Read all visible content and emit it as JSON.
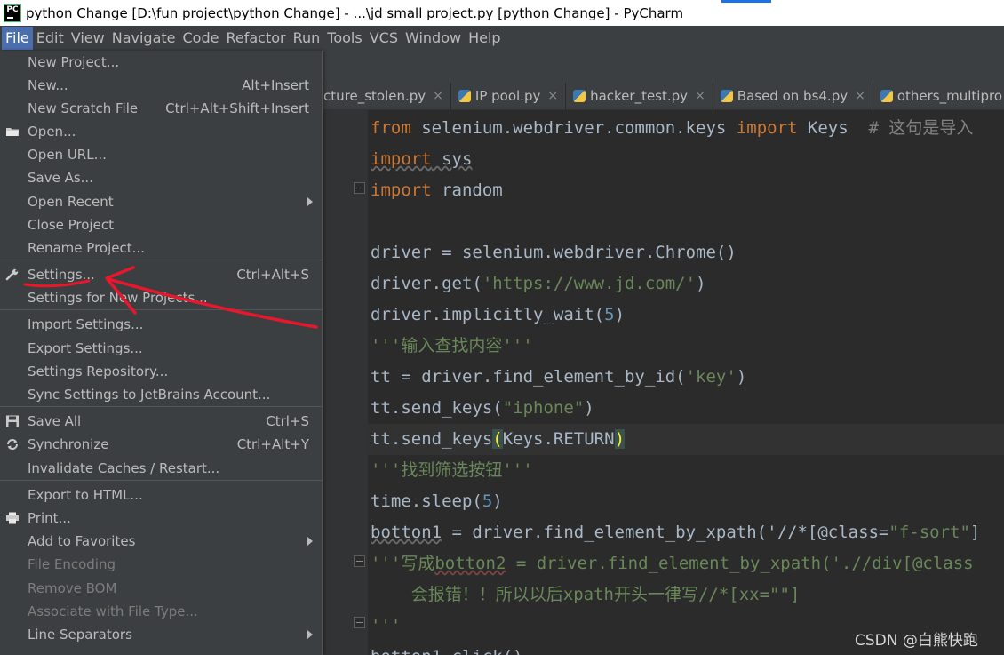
{
  "window": {
    "title": "python Change [D:\\fun project\\python Change] - ...\\jd small project.py [python Change] - PyCharm",
    "logo": "PC"
  },
  "menubar": [
    "File",
    "Edit",
    "View",
    "Navigate",
    "Code",
    "Refactor",
    "Run",
    "Tools",
    "VCS",
    "Window",
    "Help"
  ],
  "tabs": [
    "cture_stolen.py",
    "IP pool.py",
    "hacker_test.py",
    "Based on bs4.py",
    "others_multipro"
  ],
  "tab_close_glyph": "×",
  "file_menu": [
    {
      "label": "New Project...",
      "shortcut": ""
    },
    {
      "label": "New...",
      "shortcut": "Alt+Insert"
    },
    {
      "label": "New Scratch File",
      "shortcut": "Ctrl+Alt+Shift+Insert"
    },
    {
      "label": "Open...",
      "shortcut": "",
      "icon": "folder-icon"
    },
    {
      "label": "Open URL...",
      "shortcut": ""
    },
    {
      "label": "Save As...",
      "shortcut": ""
    },
    {
      "label": "Open Recent",
      "shortcut": "",
      "submenu": true
    },
    {
      "label": "Close Project",
      "shortcut": ""
    },
    {
      "label": "Rename Project...",
      "shortcut": ""
    },
    {
      "label": "Settings...",
      "shortcut": "Ctrl+Alt+S",
      "icon": "wrench-icon"
    },
    {
      "label": "Settings for New Projects...",
      "shortcut": ""
    },
    {
      "label": "Import Settings...",
      "shortcut": ""
    },
    {
      "label": "Export Settings...",
      "shortcut": ""
    },
    {
      "label": "Settings Repository...",
      "shortcut": ""
    },
    {
      "label": "Sync Settings to JetBrains Account...",
      "shortcut": ""
    },
    {
      "label": "Save All",
      "shortcut": "Ctrl+S",
      "icon": "save-icon"
    },
    {
      "label": "Synchronize",
      "shortcut": "Ctrl+Alt+Y",
      "icon": "sync-icon"
    },
    {
      "label": "Invalidate Caches / Restart...",
      "shortcut": ""
    },
    {
      "label": "Export to HTML...",
      "shortcut": ""
    },
    {
      "label": "Print...",
      "shortcut": "",
      "icon": "print-icon"
    },
    {
      "label": "Add to Favorites",
      "shortcut": "",
      "submenu": true
    },
    {
      "label": "File Encoding",
      "shortcut": "",
      "disabled": true
    },
    {
      "label": "Remove BOM",
      "shortcut": "",
      "disabled": true
    },
    {
      "label": "Associate with File Type...",
      "shortcut": "",
      "disabled": true
    },
    {
      "label": "Line Separators",
      "shortcut": "",
      "submenu": true
    }
  ],
  "code_lines": [
    "from selenium.webdriver.common.keys import Keys  # 这句是导入",
    "import sys",
    "import random",
    "",
    "driver = selenium.webdriver.Chrome()",
    "driver.get('https://www.jd.com/')",
    "driver.implicitly_wait(5)",
    "'''输入查找内容'''",
    "tt = driver.find_element_by_id('key')",
    "tt.send_keys(\"iphone\")",
    "tt.send_keys(Keys.RETURN)",
    "'''找到筛选按钮'''",
    "time.sleep(5)",
    "botton1 = driver.find_element_by_xpath('//*[@class=\"f-sort\"]",
    "'''写成botton2 = driver.find_element_by_xpath('.//div[@class",
    "    会报错！！所以以后xpath开头一律写//*[xx=\"\"]",
    "'''",
    "botton1.click()"
  ],
  "watermark": "CSDN @白熊快跑",
  "colors": {
    "keyword": "#cc7832",
    "string": "#6a8759",
    "number": "#6897bb",
    "selection": "#4b6eaf",
    "annotation": "#e8172b"
  }
}
